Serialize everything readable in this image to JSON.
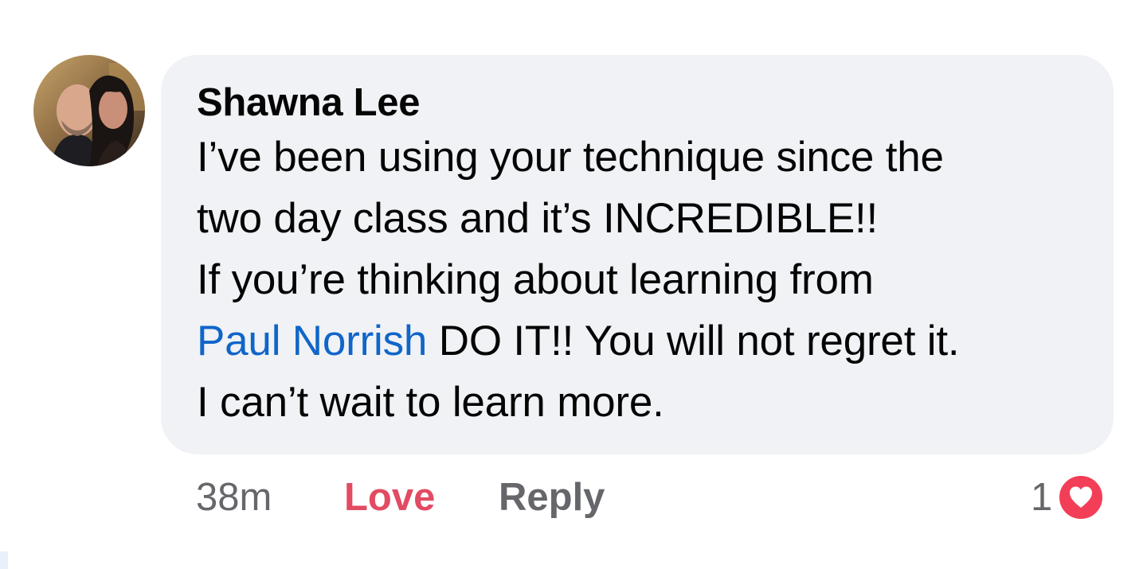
{
  "comment": {
    "author": "Shawna Lee",
    "text_lines": [
      "I’ve been using your technique since the",
      "two day class and it’s INCREDIBLE!!",
      "If you’re thinking about learning from"
    ],
    "mention": "Paul Norrish",
    "mention_suffix": " DO IT!! You will not regret it.",
    "last_line": "I can’t wait to learn more.",
    "time_ago": "38m",
    "love_label": "Love",
    "reply_label": "Reply",
    "reaction_count": "1",
    "reaction_icon": "heart-icon"
  },
  "colors": {
    "bubble_bg": "#f0f2f5",
    "mention": "#1065c9",
    "love": "#e24b62",
    "secondary_text": "#65676b",
    "heart_badge": "#f33e58"
  }
}
